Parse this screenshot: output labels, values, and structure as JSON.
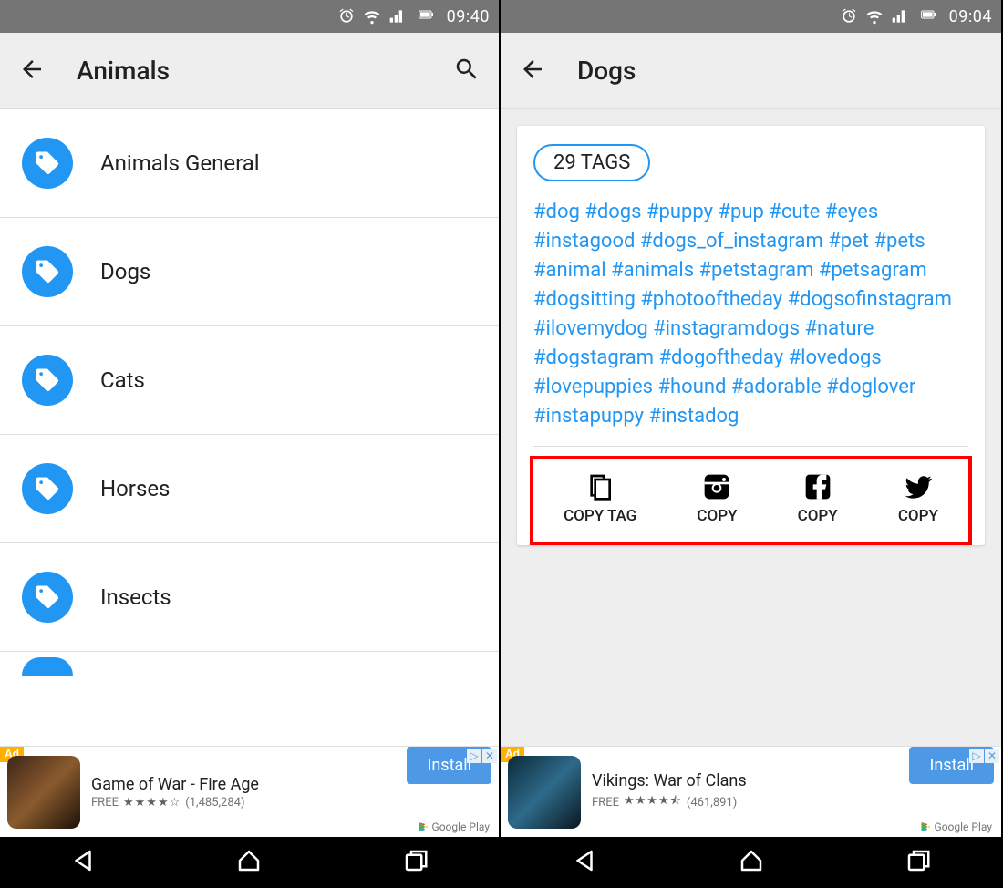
{
  "left": {
    "status": {
      "time": "09:40"
    },
    "title": "Animals",
    "items": [
      {
        "label": "Animals General"
      },
      {
        "label": "Dogs"
      },
      {
        "label": "Cats"
      },
      {
        "label": "Horses"
      },
      {
        "label": "Insects"
      }
    ],
    "ad": {
      "badge": "Ad",
      "title": "Game of War - Fire Age",
      "price": "FREE",
      "reviews": "(1,485,284)",
      "button": "Install",
      "store": "Google Play"
    }
  },
  "right": {
    "status": {
      "time": "09:04"
    },
    "title": "Dogs",
    "tag_count": "29 TAGS",
    "hashtags": "#dog #dogs #puppy #pup #cute #eyes #instagood #dogs_of_instagram #pet #pets #animal #animals #petstagram #petsagram #dogsitting #photooftheday #dogsofinstagram #ilovemydog #instagramdogs #nature #dogstagram #dogoftheday #lovedogs #lovepuppies #hound #adorable #doglover #instapuppy #instadog",
    "actions": [
      {
        "label": "COPY TAG"
      },
      {
        "label": "COPY"
      },
      {
        "label": "COPY"
      },
      {
        "label": "COPY"
      }
    ],
    "ad": {
      "badge": "Ad",
      "title": "Vikings: War of Clans",
      "price": "FREE",
      "reviews": "(461,891)",
      "button": "Install",
      "store": "Google Play"
    }
  }
}
